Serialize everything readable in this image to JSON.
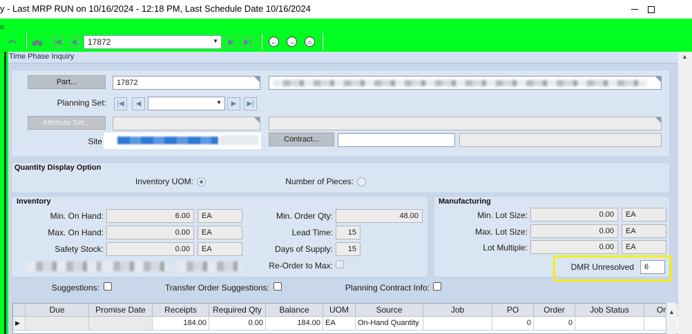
{
  "window": {
    "title": "y - Last MRP RUN on 10/16/2024 - 12:18 PM, Last Schedule Date  10/16/2024",
    "minimize_label": "",
    "maximize_label": ""
  },
  "toolbar": {
    "part_combo_value": "17872",
    "icons": [
      "undo-icon",
      "binoculars-icon",
      "first-record-icon",
      "previous-record-icon",
      "next-record-icon",
      "last-record-icon",
      "back-icon",
      "forward-icon",
      "home-icon"
    ]
  },
  "form": {
    "window_title": "Time Phase Inquiry",
    "part_button": "Part...",
    "part_value": "17872",
    "planning_set_label": "Planning Set:",
    "planning_set_value": "",
    "attribute_set_button": "Attribute Set...",
    "site_label": "Site",
    "contract_button": "Contract...",
    "contract_value": ""
  },
  "quantity_display": {
    "title": "Quantity Display Option",
    "inventory_uom_label": "Inventory UOM:",
    "number_of_pieces_label": "Number of Pieces:",
    "selected": "inventory_uom"
  },
  "inventory": {
    "title": "Inventory",
    "min_on_hand_label": "Min. On Hand:",
    "min_on_hand_value": "6.00",
    "min_on_hand_uom": "EA",
    "max_on_hand_label": "Max. On Hand:",
    "max_on_hand_value": "0.00",
    "max_on_hand_uom": "EA",
    "safety_stock_label": "Safety Stock:",
    "safety_stock_value": "0.00",
    "safety_stock_uom": "EA",
    "min_order_qty_label": "Min. Order Qty:",
    "min_order_qty_value": "48.00",
    "lead_time_label": "Lead Time:",
    "lead_time_value": "15",
    "days_of_supply_label": "Days of Supply:",
    "days_of_supply_value": "15",
    "reorder_to_max_label": "Re-Order to Max:"
  },
  "manufacturing": {
    "title": "Manufacturing",
    "min_lot_size_label": "Min. Lot Size:",
    "min_lot_size_value": "0.00",
    "min_lot_size_uom": "EA",
    "max_lot_size_label": "Max. Lot Size:",
    "max_lot_size_value": "0.00",
    "max_lot_size_uom": "EA",
    "lot_multiple_label": "Lot Multiple:",
    "lot_multiple_value": "0.00",
    "lot_multiple_uom": "EA",
    "dmr_unresolved_label": "DMR Unresolved",
    "dmr_unresolved_value": "6"
  },
  "options": {
    "suggestions_label": "Suggestions:",
    "transfer_order_suggestions_label": "Transfer Order Suggestions:",
    "planning_contract_info_label": "Planning Contract Info:"
  },
  "grid": {
    "columns": [
      "Due",
      "Promise Date",
      "Receipts",
      "Required Qty",
      "Balance",
      "UOM",
      "Source",
      "Job",
      "PO",
      "Order",
      "Job Status",
      "Or"
    ],
    "rows": [
      [
        "",
        "",
        "184.00",
        "0.00",
        "184.00",
        "EA",
        "On-Hand Quantity",
        "",
        "0",
        "0",
        "",
        ""
      ]
    ]
  },
  "colors": {
    "toolbar_green": "#00ff21",
    "panel_blue": "#d9e5f3",
    "highlight_yellow": "#f5ef00"
  }
}
